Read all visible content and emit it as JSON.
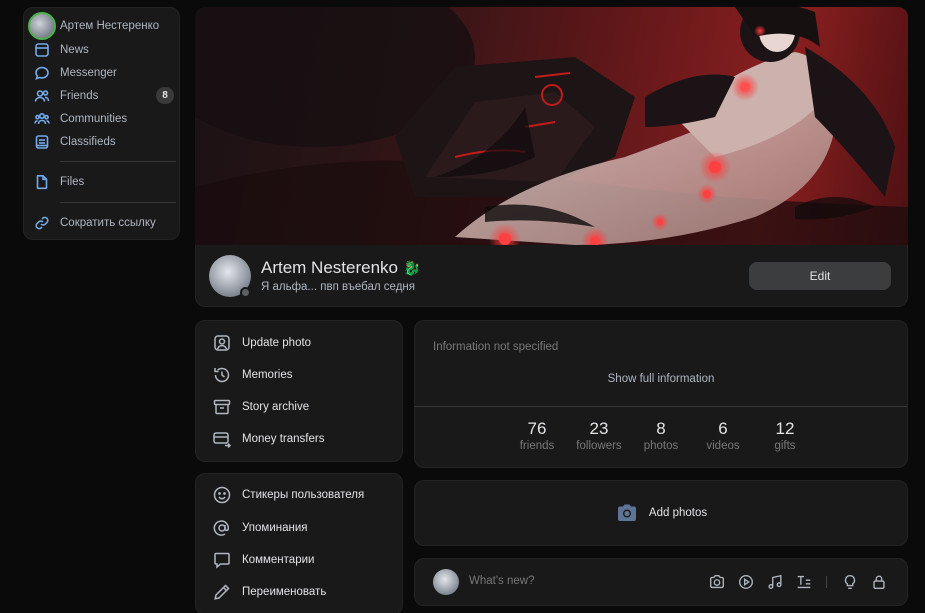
{
  "sidebar": {
    "user_name": "Артем Нестеренко",
    "items": [
      {
        "label": "News",
        "icon": "news-icon"
      },
      {
        "label": "Messenger",
        "icon": "messenger-icon"
      },
      {
        "label": "Friends",
        "icon": "friends-icon",
        "badge": "8"
      },
      {
        "label": "Communities",
        "icon": "communities-icon"
      },
      {
        "label": "Classifieds",
        "icon": "classifieds-icon"
      },
      {
        "label": "Files",
        "icon": "files-icon"
      },
      {
        "label": "Сократить ссылку",
        "icon": "link-icon"
      }
    ]
  },
  "profile": {
    "name": "Artem Nesterenko",
    "name_emoji": "🐉",
    "status": "Я альфа... пвп въебал седня",
    "edit_label": "Edit"
  },
  "actions_primary": [
    {
      "label": "Update photo",
      "icon": "update-photo-icon"
    },
    {
      "label": "Memories",
      "icon": "memories-icon"
    },
    {
      "label": "Story archive",
      "icon": "archive-icon"
    },
    {
      "label": "Money transfers",
      "icon": "money-transfer-icon"
    }
  ],
  "actions_secondary": [
    {
      "label": "Стикеры пользователя",
      "icon": "smile-icon"
    },
    {
      "label": "Упоминания",
      "icon": "mention-icon"
    },
    {
      "label": "Комментарии",
      "icon": "comment-icon"
    },
    {
      "label": "Переименовать",
      "icon": "pencil-icon"
    }
  ],
  "info": {
    "empty_text": "Information not specified",
    "show_full": "Show full information",
    "counters": [
      {
        "value": "76",
        "label": "friends"
      },
      {
        "value": "23",
        "label": "followers"
      },
      {
        "value": "8",
        "label": "photos"
      },
      {
        "value": "6",
        "label": "videos"
      },
      {
        "value": "12",
        "label": "gifts"
      }
    ]
  },
  "photos": {
    "add_label": "Add photos"
  },
  "composer": {
    "placeholder": "What's new?",
    "tools": [
      "camera-icon",
      "video-icon",
      "music-icon",
      "text-format-icon",
      "bulb-icon",
      "lock-icon"
    ]
  },
  "colors": {
    "accent": "#71aaeb",
    "online": "#4bb34b",
    "background": "#0a0a0a",
    "panel": "#191919"
  }
}
